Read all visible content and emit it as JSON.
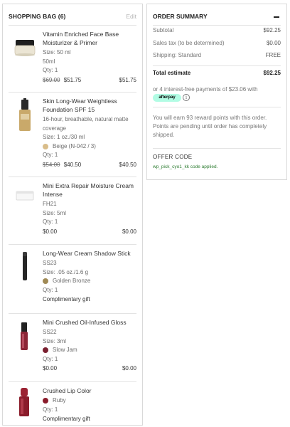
{
  "bag": {
    "title": "SHOPPING BAG (6)",
    "edit_label": "Edit",
    "items": [
      {
        "name": "Vitamin Enriched Face Base Moisturizer & Primer",
        "lines": [
          "Size: 50 ml",
          "50ml",
          "Qty: 1"
        ],
        "original_price": "$69.00",
        "sale_price": "$51.75",
        "total": "$51.75",
        "thumb_icon": "face-base-jar"
      },
      {
        "name": "Skin Long-Wear Weightless Foundation SPF 15",
        "lines": [
          "16-hour, breathable, natural matte coverage",
          "Size: 1 oz./30 ml"
        ],
        "shade": "Beige (N-042 / 3)",
        "shade_color": "#d9bd8a",
        "qty": "Qty: 1",
        "original_price": "$54.00",
        "sale_price": "$40.50",
        "total": "$40.50",
        "thumb_icon": "foundation-bottle"
      },
      {
        "name": "Mini Extra Repair Moisture Cream Intense",
        "lines": [
          "FH21",
          "Size: 5ml",
          "Qty: 1"
        ],
        "price": "$0.00",
        "total": "$0.00",
        "thumb_icon": "cream-jar"
      },
      {
        "name": "Long-Wear Cream Shadow Stick",
        "lines": [
          "SS23",
          "Size: .05 oz./1.6 g"
        ],
        "shade": "Golden Bronze",
        "shade_color": "#a08a55",
        "qty": "Qty: 1",
        "complimentary": "Complimentary gift",
        "thumb_icon": "shadow-stick"
      },
      {
        "name": "Mini Crushed Oil-Infused Gloss",
        "lines": [
          "SS22",
          "Size: 3ml"
        ],
        "shade": "Slow Jam",
        "shade_color": "#7a2030",
        "qty": "Qty: 1",
        "price": "$0.00",
        "total": "$0.00",
        "thumb_icon": "gloss-tube"
      },
      {
        "name": "Crushed Lip Color",
        "shade": "Ruby",
        "shade_color": "#8a1c2b",
        "qty": "Qty: 1",
        "complimentary": "Complimentary gift",
        "thumb_icon": "lipstick"
      }
    ]
  },
  "summary": {
    "title": "ORDER SUMMARY",
    "subtotal_label": "Subtotal",
    "subtotal": "$92.25",
    "tax_label": "Sales tax (to be determined)",
    "tax": "$0.00",
    "shipping_label": "Shipping: Standard",
    "shipping": "FREE",
    "total_label": "Total estimate",
    "total": "$92.25",
    "afterpay_text": "or 4 interest-free payments of $23.06 with",
    "afterpay_badge": "afterpay",
    "info_glyph": "i",
    "reward_text": "You will earn 93 reward points with this order. Points are pending until order has completely shipped.",
    "offer_title": "OFFER CODE",
    "offer_applied": "wp_pick_cyo1_kk code applied."
  },
  "colors": {
    "border": "#d9d9d9",
    "afterpay_mint": "#b2fce4",
    "applied_green": "#2e7d32"
  }
}
